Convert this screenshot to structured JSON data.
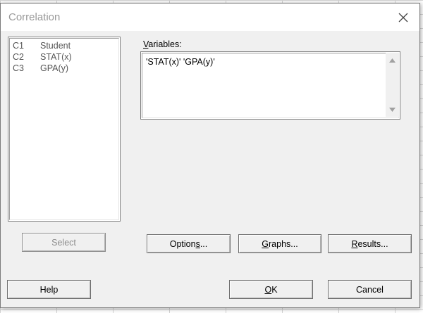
{
  "dialog": {
    "title": "Correlation",
    "close_icon": "close-icon"
  },
  "variable_list": {
    "items": [
      {
        "column": "C1",
        "name": "Student"
      },
      {
        "column": "C2",
        "name": "STAT(x)"
      },
      {
        "column": "C3",
        "name": "GPA(y)"
      }
    ]
  },
  "variables": {
    "label_prefix": "",
    "label_accel": "V",
    "label_rest": "ariables:",
    "value": "'STAT(x)' 'GPA(y)'"
  },
  "buttons": {
    "select": "Select",
    "options_pre": "Option",
    "options_accel": "s",
    "options_post": "...",
    "graphs_pre": "",
    "graphs_accel": "G",
    "graphs_post": "raphs...",
    "results_pre": "",
    "results_accel": "R",
    "results_post": "esults...",
    "help": "Help",
    "ok_pre": "",
    "ok_accel": "O",
    "ok_post": "K",
    "cancel": "Cancel"
  },
  "colors": {
    "dialog_bg": "#f0f0f0",
    "title_text": "#999999",
    "disabled_text": "#8c8c8c"
  }
}
